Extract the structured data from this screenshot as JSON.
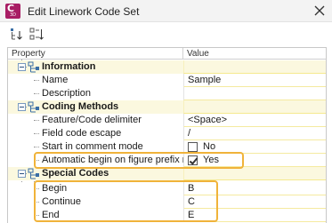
{
  "window": {
    "title": "Edit Linework Code Set",
    "app_icon_letter": "C",
    "app_icon_sub": "3D"
  },
  "toolbar": {
    "buttons": [
      {
        "icon": "sort-categorized-icon"
      },
      {
        "icon": "sort-alphabetical-icon"
      }
    ]
  },
  "grid": {
    "header": {
      "property": "Property",
      "value": "Value"
    },
    "categories": {
      "information": {
        "label": "Information"
      },
      "coding_methods": {
        "label": "Coding Methods"
      },
      "special_codes": {
        "label": "Special Codes"
      }
    },
    "rows": {
      "name": {
        "label": "Name",
        "value": "Sample"
      },
      "description": {
        "label": "Description",
        "value": ""
      },
      "delimiter": {
        "label": "Feature/Code delimiter",
        "value": "<Space>"
      },
      "escape": {
        "label": "Field code escape",
        "value": "/"
      },
      "comment_mode": {
        "label": "Start in comment mode",
        "value": "No",
        "checked": false
      },
      "auto_begin": {
        "label": "Automatic begin on figure prefix match",
        "value": "Yes",
        "checked": true
      },
      "begin": {
        "label": "Begin",
        "value": "B"
      },
      "continue": {
        "label": "Continue",
        "value": "C"
      },
      "end": {
        "label": "End",
        "value": "E"
      }
    }
  },
  "colors": {
    "category_background": "#fbf8df",
    "highlight": "#f0b33a",
    "app_icon": "#a81d64"
  }
}
